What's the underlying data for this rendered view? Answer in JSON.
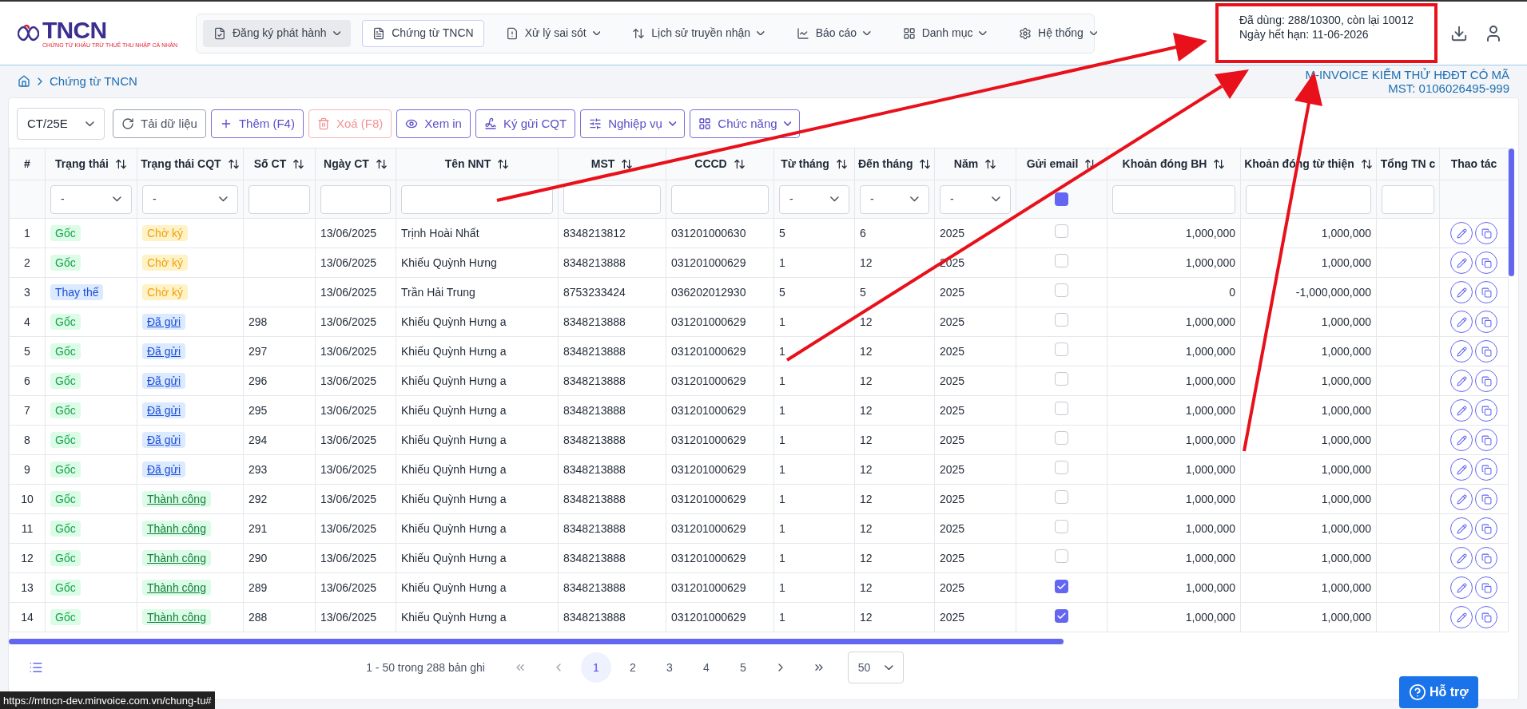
{
  "logo": {
    "name": "TNCN",
    "tagline": "CHỨNG TỪ KHẤU TRỪ THUẾ THU NHẬP CÁ NHÂN"
  },
  "nav": [
    {
      "label": "Đăng ký phát hành",
      "dropdown": true,
      "selected": false,
      "hovered": true
    },
    {
      "label": "Chứng từ TNCN",
      "dropdown": false,
      "selected": true,
      "hovered": false
    },
    {
      "label": "Xử lý sai sót",
      "dropdown": true,
      "selected": false,
      "hovered": false
    },
    {
      "label": "Lịch sử truyền nhận",
      "dropdown": true,
      "selected": false,
      "hovered": false
    },
    {
      "label": "Báo cáo",
      "dropdown": true,
      "selected": false,
      "hovered": false
    },
    {
      "label": "Danh mục",
      "dropdown": true,
      "selected": false,
      "hovered": false
    },
    {
      "label": "Hệ thống",
      "dropdown": true,
      "selected": false,
      "hovered": false
    }
  ],
  "usage": {
    "used": "Đã dùng: 288/10300, còn lại 10012",
    "expiry": "Ngày hết hạn: 11-06-2026"
  },
  "breadcrumb": [
    "Chứng từ TNCN"
  ],
  "company": {
    "name": "M-INVOICE KIỂM THỬ HĐĐT CÓ MÃ",
    "tax_code": "MST: 0106026495-999"
  },
  "series_select": {
    "value": "CT/25E"
  },
  "toolbar": [
    {
      "label": "Tải dữ liệu",
      "kind": "neutral",
      "disabled": false,
      "dropdown": false
    },
    {
      "label": "Thêm (F4)",
      "kind": "primary",
      "disabled": false,
      "dropdown": false
    },
    {
      "label": "Xoá (F8)",
      "kind": "danger",
      "disabled": true,
      "dropdown": false
    },
    {
      "label": "Xem in",
      "kind": "primary",
      "disabled": false,
      "dropdown": false
    },
    {
      "label": "Ký gửi CQT",
      "kind": "primary",
      "disabled": false,
      "dropdown": false
    },
    {
      "label": "Nghiệp vụ",
      "kind": "primary",
      "disabled": false,
      "dropdown": true
    },
    {
      "label": "Chức năng",
      "kind": "primary",
      "disabled": false,
      "dropdown": true
    }
  ],
  "table": {
    "columns": [
      {
        "label": "#",
        "sortable": false
      },
      {
        "label": "Trạng thái",
        "sortable": true
      },
      {
        "label": "Trạng thái CQT",
        "sortable": true
      },
      {
        "label": "Số CT",
        "sortable": true
      },
      {
        "label": "Ngày CT",
        "sortable": true
      },
      {
        "label": "Tên NNT",
        "sortable": true
      },
      {
        "label": "MST",
        "sortable": true
      },
      {
        "label": "CCCD",
        "sortable": true
      },
      {
        "label": "Từ tháng",
        "sortable": true
      },
      {
        "label": "Đến tháng",
        "sortable": true
      },
      {
        "label": "Năm",
        "sortable": true
      },
      {
        "label": "Gửi email",
        "sortable": true
      },
      {
        "label": "Khoản đóng BH",
        "sortable": true
      },
      {
        "label": "Khoản đóng từ thiện",
        "sortable": true
      },
      {
        "label": "Tổng TN c",
        "sortable": false
      },
      {
        "label": "Thao tác",
        "sortable": false
      }
    ],
    "filters": [
      {
        "kind": "none"
      },
      {
        "kind": "select",
        "value": "-"
      },
      {
        "kind": "select",
        "value": "-"
      },
      {
        "kind": "text"
      },
      {
        "kind": "text"
      },
      {
        "kind": "text"
      },
      {
        "kind": "text"
      },
      {
        "kind": "text"
      },
      {
        "kind": "select",
        "value": "-"
      },
      {
        "kind": "select",
        "value": "-"
      },
      {
        "kind": "select",
        "value": "-"
      },
      {
        "kind": "checkbox",
        "indeterminate": true
      },
      {
        "kind": "text"
      },
      {
        "kind": "text"
      },
      {
        "kind": "text"
      },
      {
        "kind": "none"
      }
    ],
    "rows": [
      {
        "no": "1",
        "status": {
          "label": "Gốc",
          "kind": "original"
        },
        "cqt": {
          "label": "Chờ ký",
          "kind": "pending"
        },
        "date": "13/06/2025",
        "name": "Trịnh Hoài Nhất",
        "mst": "8348213812",
        "cccd": "031201000630",
        "from": "5",
        "to": "6",
        "year": "2025",
        "email": false,
        "insurance": "1,000,000",
        "charity": "1,000,000"
      },
      {
        "no": "2",
        "status": {
          "label": "Gốc",
          "kind": "original"
        },
        "cqt": {
          "label": "Chờ ký",
          "kind": "pending"
        },
        "date": "13/06/2025",
        "name": "Khiếu Quỳnh Hưng",
        "mst": "8348213888",
        "cccd": "031201000629",
        "from": "1",
        "to": "12",
        "year": "2025",
        "email": false,
        "insurance": "1,000,000",
        "charity": "1,000,000"
      },
      {
        "no": "3",
        "status": {
          "label": "Thay thế",
          "kind": "replacement"
        },
        "cqt": {
          "label": "Chờ ký",
          "kind": "pending"
        },
        "date": "13/06/2025",
        "name": "Trần Hải Trung",
        "mst": "8753233424",
        "cccd": "036202012930",
        "from": "5",
        "to": "5",
        "year": "2025",
        "email": false,
        "insurance": "0",
        "charity": "-1,000,000,000"
      },
      {
        "no": "4",
        "status": {
          "label": "Gốc",
          "kind": "original"
        },
        "cqt": {
          "label": "Đã gửi",
          "kind": "sent"
        },
        "number": "298",
        "date": "13/06/2025",
        "name": "Khiếu Quỳnh Hưng a",
        "mst": "8348213888",
        "cccd": "031201000629",
        "from": "1",
        "to": "12",
        "year": "2025",
        "email": false,
        "insurance": "1,000,000",
        "charity": "1,000,000"
      },
      {
        "no": "5",
        "status": {
          "label": "Gốc",
          "kind": "original"
        },
        "cqt": {
          "label": "Đã gửi",
          "kind": "sent"
        },
        "number": "297",
        "date": "13/06/2025",
        "name": "Khiếu Quỳnh Hưng a",
        "mst": "8348213888",
        "cccd": "031201000629",
        "from": "1",
        "to": "12",
        "year": "2025",
        "email": false,
        "insurance": "1,000,000",
        "charity": "1,000,000"
      },
      {
        "no": "6",
        "status": {
          "label": "Gốc",
          "kind": "original"
        },
        "cqt": {
          "label": "Đã gửi",
          "kind": "sent"
        },
        "number": "296",
        "date": "13/06/2025",
        "name": "Khiếu Quỳnh Hưng a",
        "mst": "8348213888",
        "cccd": "031201000629",
        "from": "1",
        "to": "12",
        "year": "2025",
        "email": false,
        "insurance": "1,000,000",
        "charity": "1,000,000"
      },
      {
        "no": "7",
        "status": {
          "label": "Gốc",
          "kind": "original"
        },
        "cqt": {
          "label": "Đã gửi",
          "kind": "sent"
        },
        "number": "295",
        "date": "13/06/2025",
        "name": "Khiếu Quỳnh Hưng a",
        "mst": "8348213888",
        "cccd": "031201000629",
        "from": "1",
        "to": "12",
        "year": "2025",
        "email": false,
        "insurance": "1,000,000",
        "charity": "1,000,000"
      },
      {
        "no": "8",
        "status": {
          "label": "Gốc",
          "kind": "original"
        },
        "cqt": {
          "label": "Đã gửi",
          "kind": "sent"
        },
        "number": "294",
        "date": "13/06/2025",
        "name": "Khiếu Quỳnh Hưng a",
        "mst": "8348213888",
        "cccd": "031201000629",
        "from": "1",
        "to": "12",
        "year": "2025",
        "email": false,
        "insurance": "1,000,000",
        "charity": "1,000,000"
      },
      {
        "no": "9",
        "status": {
          "label": "Gốc",
          "kind": "original"
        },
        "cqt": {
          "label": "Đã gửi",
          "kind": "sent"
        },
        "number": "293",
        "date": "13/06/2025",
        "name": "Khiếu Quỳnh Hưng a",
        "mst": "8348213888",
        "cccd": "031201000629",
        "from": "1",
        "to": "12",
        "year": "2025",
        "email": false,
        "insurance": "1,000,000",
        "charity": "1,000,000"
      },
      {
        "no": "10",
        "status": {
          "label": "Gốc",
          "kind": "original"
        },
        "cqt": {
          "label": "Thành công",
          "kind": "success"
        },
        "number": "292",
        "date": "13/06/2025",
        "name": "Khiếu Quỳnh Hưng a",
        "mst": "8348213888",
        "cccd": "031201000629",
        "from": "1",
        "to": "12",
        "year": "2025",
        "email": false,
        "insurance": "1,000,000",
        "charity": "1,000,000"
      },
      {
        "no": "11",
        "status": {
          "label": "Gốc",
          "kind": "original"
        },
        "cqt": {
          "label": "Thành công",
          "kind": "success"
        },
        "number": "291",
        "date": "13/06/2025",
        "name": "Khiếu Quỳnh Hưng a",
        "mst": "8348213888",
        "cccd": "031201000629",
        "from": "1",
        "to": "12",
        "year": "2025",
        "email": false,
        "insurance": "1,000,000",
        "charity": "1,000,000"
      },
      {
        "no": "12",
        "status": {
          "label": "Gốc",
          "kind": "original"
        },
        "cqt": {
          "label": "Thành công",
          "kind": "success"
        },
        "number": "290",
        "date": "13/06/2025",
        "name": "Khiếu Quỳnh Hưng a",
        "mst": "8348213888",
        "cccd": "031201000629",
        "from": "1",
        "to": "12",
        "year": "2025",
        "email": false,
        "insurance": "1,000,000",
        "charity": "1,000,000"
      },
      {
        "no": "13",
        "status": {
          "label": "Gốc",
          "kind": "original"
        },
        "cqt": {
          "label": "Thành công",
          "kind": "success"
        },
        "number": "289",
        "date": "13/06/2025",
        "name": "Khiếu Quỳnh Hưng a",
        "mst": "8348213888",
        "cccd": "031201000629",
        "from": "1",
        "to": "12",
        "year": "2025",
        "email": true,
        "insurance": "1,000,000",
        "charity": "1,000,000"
      },
      {
        "no": "14",
        "status": {
          "label": "Gốc",
          "kind": "original"
        },
        "cqt": {
          "label": "Thành công",
          "kind": "success"
        },
        "number": "288",
        "date": "13/06/2025",
        "name": "Khiếu Quỳnh Hưng a",
        "mst": "8348213888",
        "cccd": "031201000629",
        "from": "1",
        "to": "12",
        "year": "2025",
        "email": true,
        "insurance": "1,000,000",
        "charity": "1,000,000"
      }
    ]
  },
  "pagination": {
    "summary": "1 - 50 trong 288 bản ghi",
    "pages": [
      {
        "label": "1",
        "selected": true
      },
      {
        "label": "2",
        "selected": false
      },
      {
        "label": "3",
        "selected": false
      },
      {
        "label": "4",
        "selected": false
      },
      {
        "label": "5",
        "selected": false
      }
    ],
    "page_size": "50"
  },
  "help_button": {
    "label": "Hỗ trợ"
  },
  "status_url": "https://mtncn-dev.minvoice.com.vn/chung-tu#"
}
